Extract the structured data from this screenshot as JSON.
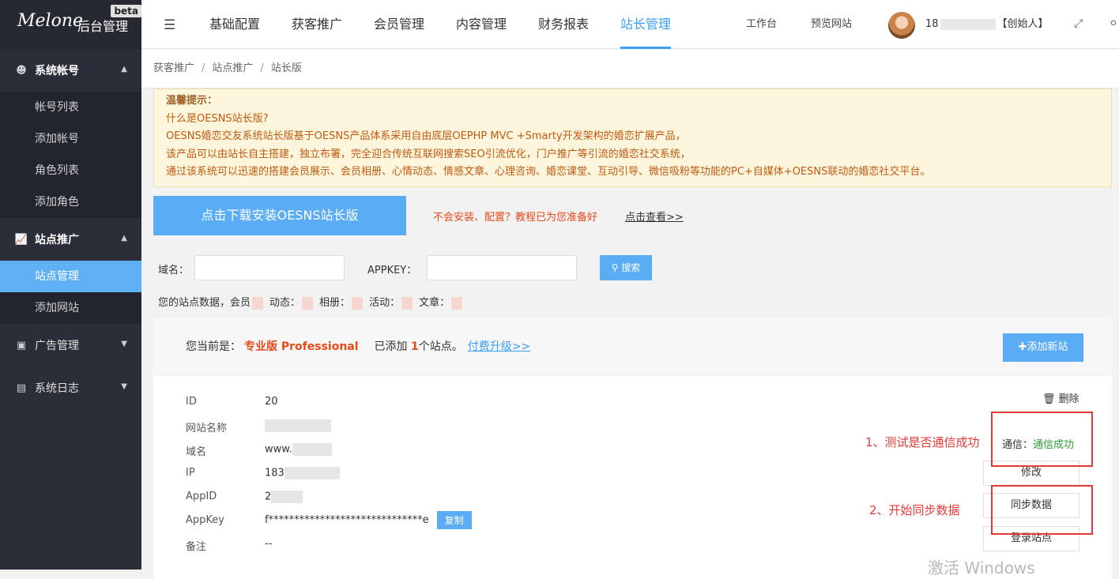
{
  "sidebar": {
    "brand": "Melone",
    "brand_text": "后台管理",
    "beta": "beta",
    "groups": [
      {
        "label": "系统帐号",
        "items": [
          "帐号列表",
          "添加帐号",
          "角色列表",
          "添加角色"
        ]
      },
      {
        "label": "站点推广",
        "items": [
          "站点管理",
          "添加网站"
        ]
      },
      {
        "label": "广告管理"
      },
      {
        "label": "系统日志"
      }
    ]
  },
  "topbar": {
    "tabs": [
      "基础配置",
      "获客推广",
      "会员管理",
      "内容管理",
      "财务报表",
      "站长管理"
    ],
    "active_tab": "站长管理",
    "links": [
      "工作台",
      "预览网站"
    ],
    "user_prefix": "18",
    "user_role": "【创始人】"
  },
  "breadcrumb": [
    "获客推广",
    "站点推广",
    "站长版"
  ],
  "notice": {
    "title": "温馨提示：",
    "lines": [
      "什么是OESNS站长版?",
      "OESNS婚恋交友系统站长版基于OESNS产品体系采用自由底层OEPHP MVC +Smarty开发架构的婚恋扩展产品，",
      "该产品可以由站长自主搭建，独立布署，完全迎合传统互联网搜索SEO引流优化，门户推广等引流的婚恋社交系统，",
      "通过该系统可以迅速的搭建会员展示、会员相册、心情动态、情感文章、心理咨询、婚恋课堂、互动引导、微信吸粉等功能的PC+自媒体+OESNS联动的婚恋社交平台。"
    ]
  },
  "download_button": "点击下载安装OESNS站长版",
  "tip": "不会安装、配置？教程已为您准备好",
  "tip_link": "点击查看>>",
  "filter": {
    "domain_label": "域名：",
    "appkey_label": "APPKEY：",
    "search_button": "搜索"
  },
  "stats": {
    "prefix": "您的站点数据，",
    "labels": [
      "会员",
      "动态：",
      "相册：",
      "活动：",
      "文章："
    ]
  },
  "panel": {
    "current_prefix": "您当前是：",
    "plan": "专业版 Professional",
    "added_prefix": "已添加",
    "added_count": "1",
    "added_suffix": "个站点。",
    "upgrade": "付费升级>>",
    "add_button": "添加新站",
    "fields": [
      {
        "label": "ID",
        "value": "20"
      },
      {
        "label": "网站名称",
        "value": ""
      },
      {
        "label": "域名",
        "value": "www."
      },
      {
        "label": "IP",
        "value": "183"
      },
      {
        "label": "AppID",
        "value": "2"
      },
      {
        "label": "AppKey",
        "value": "f******************************e"
      },
      {
        "label": "备注",
        "value": "--"
      }
    ],
    "copy_button": "复制",
    "delete": "删除",
    "status_label": "通信：",
    "status_value": "通信成功",
    "buttons": [
      "修改",
      "同步数据",
      "登录站点"
    ],
    "annotations": [
      "1、测试是否通信成功",
      "2、开始同步数据"
    ]
  },
  "watermark": "激活 Windows"
}
